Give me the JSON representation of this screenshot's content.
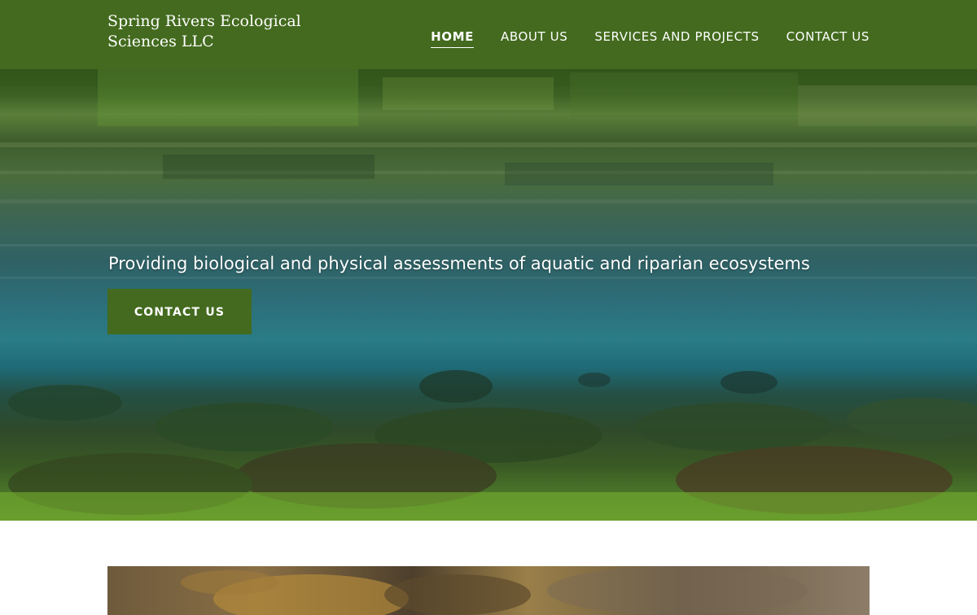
{
  "header": {
    "brand": "Spring Rivers Ecological Sciences LLC",
    "background_color": "#436a1e",
    "nav": [
      {
        "label": "HOME",
        "active": true
      },
      {
        "label": "ABOUT US",
        "active": false
      },
      {
        "label": "SERVICES AND PROJECTS",
        "active": false
      },
      {
        "label": "CONTACT US",
        "active": false
      }
    ]
  },
  "hero": {
    "tagline": "Providing biological and physical assessments of aquatic and riparian ecosystems",
    "cta_label": "CONTACT US",
    "cta_color": "#436a1e",
    "background_description_icon": "underwater-river-photo"
  },
  "feature": {
    "image_icon": "crayfish-photo"
  }
}
